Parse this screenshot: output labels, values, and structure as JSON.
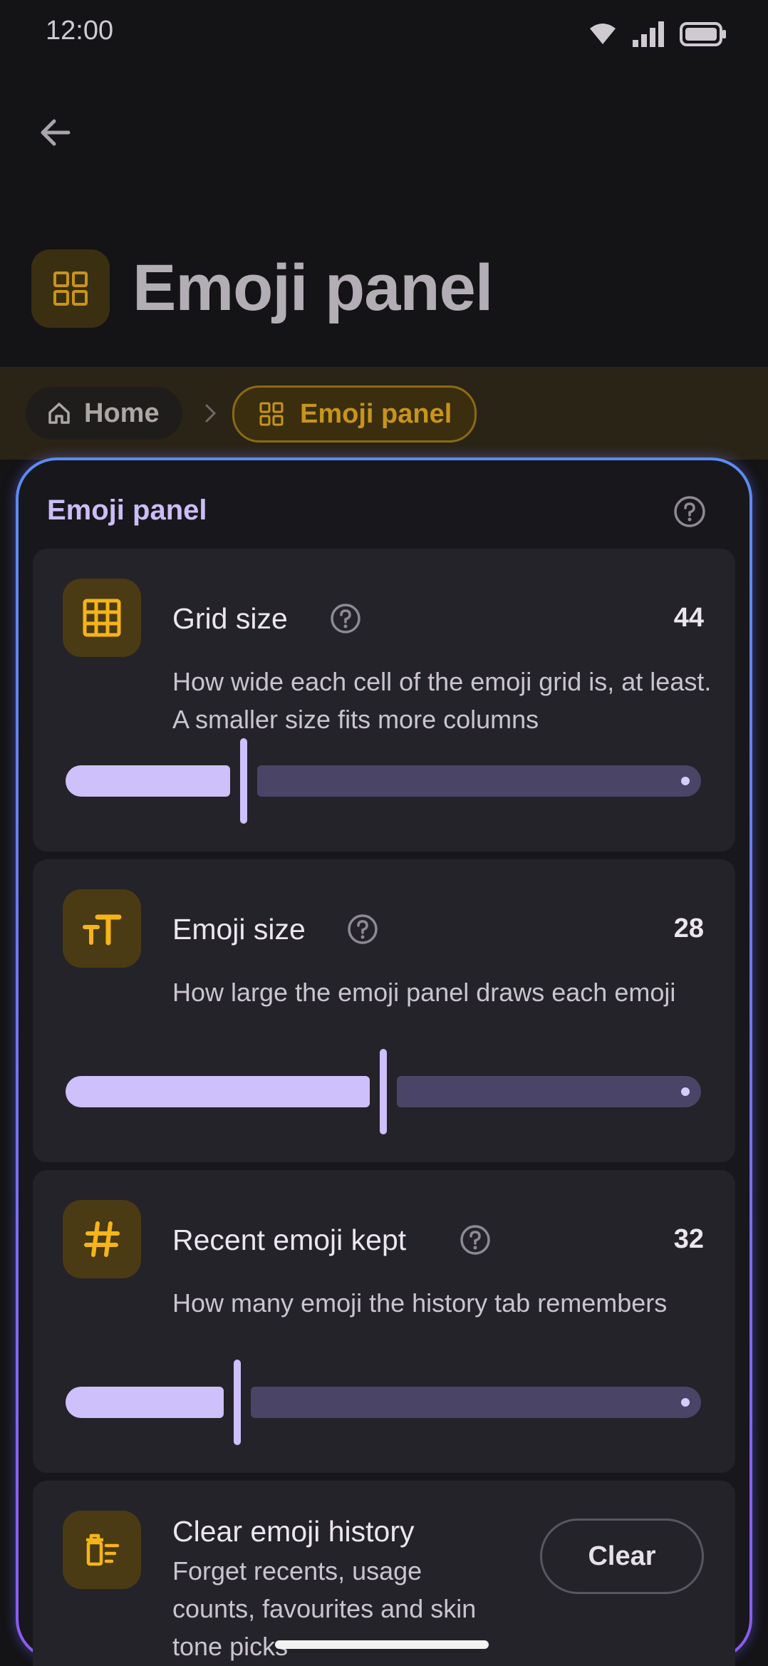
{
  "status_bar": {
    "time": "12:00"
  },
  "app_bar": {
    "title": "Emoji panel"
  },
  "breadcrumb": {
    "home_label": "Home",
    "current_label": "Emoji panel"
  },
  "panel": {
    "title": "Emoji panel",
    "settings": [
      {
        "title": "Grid size",
        "value": "44",
        "description": "How wide each cell of the emoji grid is, at least. A smaller size fits more columns",
        "fraction": 0.28,
        "icon": "grid-icon"
      },
      {
        "title": "Emoji size",
        "value": "28",
        "description": "How large the emoji panel draws each emoji",
        "fraction": 0.5,
        "icon": "text-size-icon"
      },
      {
        "title": "Recent emoji kept",
        "value": "32",
        "description": "How many emoji the history tab remembers",
        "fraction": 0.27,
        "icon": "hash-icon"
      }
    ],
    "clear_history": {
      "title": "Clear emoji history",
      "description": "Forget recents, usage counts, favourites and skin tone picks",
      "button_label": "Clear",
      "icon": "delete-sweep-icon"
    }
  },
  "colors": {
    "accent": "#cdc0fb",
    "icon_accent": "#f5b418",
    "panel_border_top": "#5b8cf0",
    "panel_border_bottom": "#8a5cf0"
  }
}
